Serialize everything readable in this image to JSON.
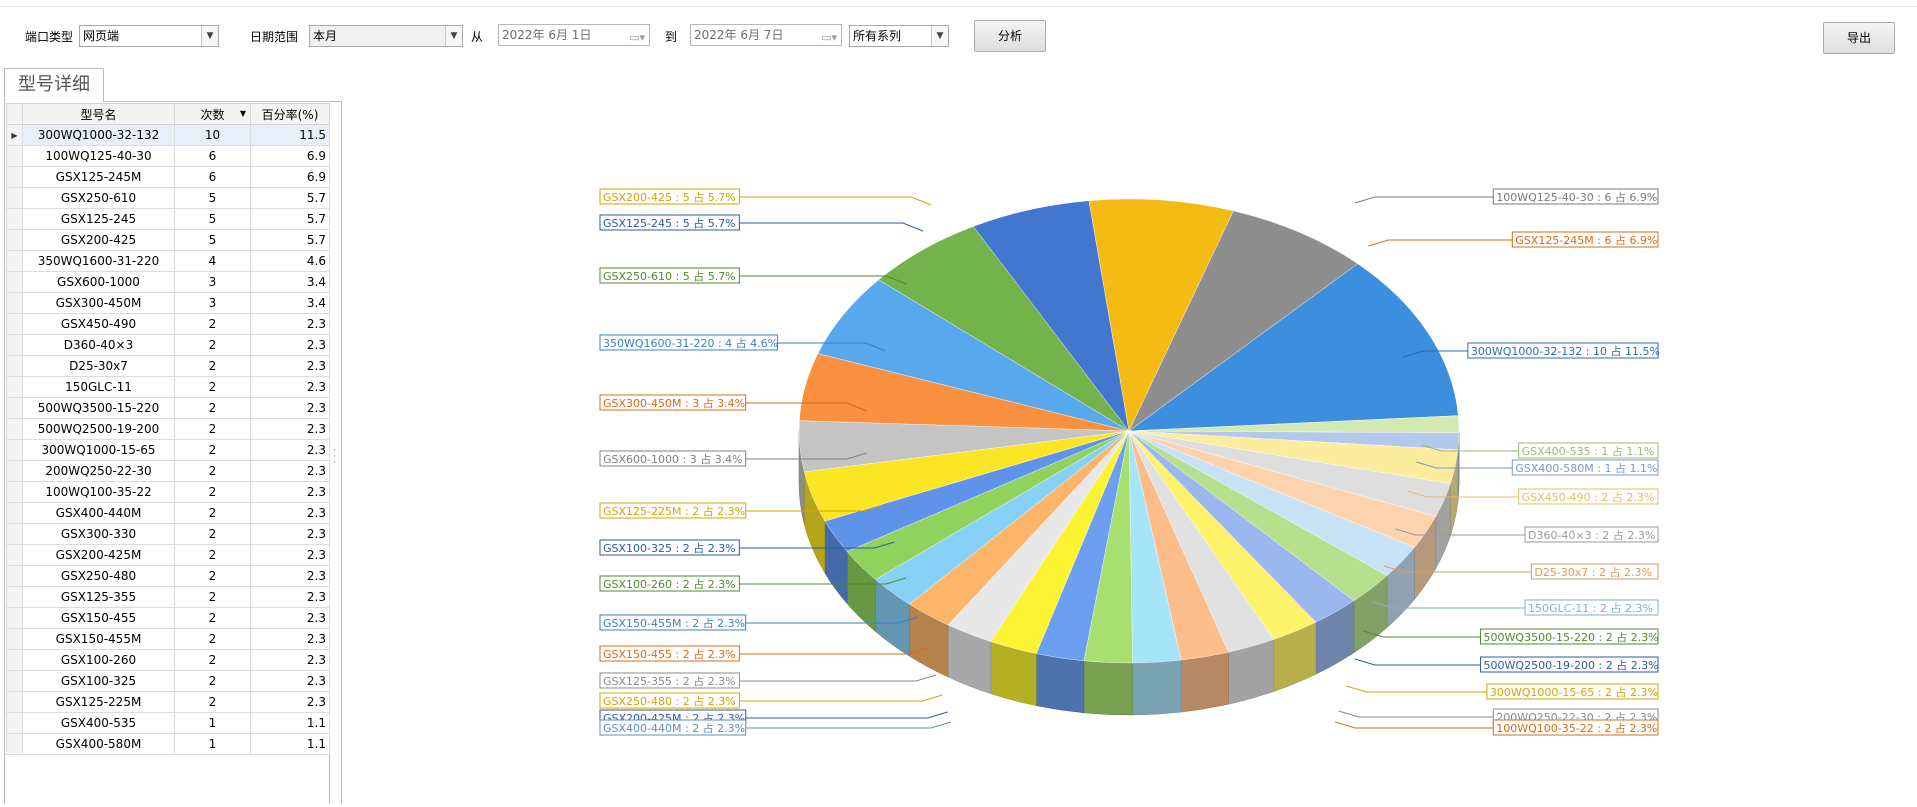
{
  "toolbar": {
    "port_type_label": "端口类型",
    "port_type_value": "网页端",
    "date_range_label": "日期范围",
    "date_range_value": "本月",
    "from_label": "从",
    "date_from": "2022年 6月 1日",
    "to_label": "到",
    "date_to": "2022年 6月 7日",
    "series_value": "所有系列",
    "analyze_label": "分析",
    "export_label": "导出"
  },
  "tab": {
    "label": "型号详细"
  },
  "table": {
    "columns": [
      "型号名",
      "次数",
      "百分率(%)"
    ],
    "rows": [
      {
        "name": "300WQ1000-32-132",
        "count": "10",
        "pct": "11.5"
      },
      {
        "name": "100WQ125-40-30",
        "count": "6",
        "pct": "6.9"
      },
      {
        "name": "GSX125-245M",
        "count": "6",
        "pct": "6.9"
      },
      {
        "name": "GSX250-610",
        "count": "5",
        "pct": "5.7"
      },
      {
        "name": "GSX125-245",
        "count": "5",
        "pct": "5.7"
      },
      {
        "name": "GSX200-425",
        "count": "5",
        "pct": "5.7"
      },
      {
        "name": "350WQ1600-31-220",
        "count": "4",
        "pct": "4.6"
      },
      {
        "name": "GSX600-1000",
        "count": "3",
        "pct": "3.4"
      },
      {
        "name": "GSX300-450M",
        "count": "3",
        "pct": "3.4"
      },
      {
        "name": "GSX450-490",
        "count": "2",
        "pct": "2.3"
      },
      {
        "name": "D360-40×3",
        "count": "2",
        "pct": "2.3"
      },
      {
        "name": "D25-30x7",
        "count": "2",
        "pct": "2.3"
      },
      {
        "name": "150GLC-11",
        "count": "2",
        "pct": "2.3"
      },
      {
        "name": "500WQ3500-15-220",
        "count": "2",
        "pct": "2.3"
      },
      {
        "name": "500WQ2500-19-200",
        "count": "2",
        "pct": "2.3"
      },
      {
        "name": "300WQ1000-15-65",
        "count": "2",
        "pct": "2.3"
      },
      {
        "name": "200WQ250-22-30",
        "count": "2",
        "pct": "2.3"
      },
      {
        "name": "100WQ100-35-22",
        "count": "2",
        "pct": "2.3"
      },
      {
        "name": "GSX400-440M",
        "count": "2",
        "pct": "2.3"
      },
      {
        "name": "GSX300-330",
        "count": "2",
        "pct": "2.3"
      },
      {
        "name": "GSX200-425M",
        "count": "2",
        "pct": "2.3"
      },
      {
        "name": "GSX250-480",
        "count": "2",
        "pct": "2.3"
      },
      {
        "name": "GSX125-355",
        "count": "2",
        "pct": "2.3"
      },
      {
        "name": "GSX150-455",
        "count": "2",
        "pct": "2.3"
      },
      {
        "name": "GSX150-455M",
        "count": "2",
        "pct": "2.3"
      },
      {
        "name": "GSX100-260",
        "count": "2",
        "pct": "2.3"
      },
      {
        "name": "GSX100-325",
        "count": "2",
        "pct": "2.3"
      },
      {
        "name": "GSX125-225M",
        "count": "2",
        "pct": "2.3"
      },
      {
        "name": "GSX400-535",
        "count": "1",
        "pct": "1.1"
      },
      {
        "name": "GSX400-580M",
        "count": "1",
        "pct": "1.1"
      }
    ]
  },
  "chart_data": {
    "type": "pie",
    "style": "3d-exploded-labels",
    "slices": [
      {
        "label": "300WQ1000-32-132 : 10 占 11.5%",
        "value": 10,
        "color": "#3c8ede"
      },
      {
        "label": "GSX400-535 : 1 占 1.1%",
        "value": 1,
        "color": "#d4e8b2"
      },
      {
        "label": "GSX400-580M : 1 占 1.1%",
        "value": 1,
        "color": "#b4c8ec"
      },
      {
        "label": "GSX450-490 : 2 占 2.3%",
        "value": 2,
        "color": "#fbec9e"
      },
      {
        "label": "D360-40×3 : 2 占 2.3%",
        "value": 2,
        "color": "#dedede"
      },
      {
        "label": "D25-30x7 : 2 占 2.3%",
        "value": 2,
        "color": "#fdd3ae"
      },
      {
        "label": "150GLC-11 : 2 占 2.3%",
        "value": 2,
        "color": "#c8e1f5"
      },
      {
        "label": "500WQ3500-15-220 : 2 占 2.3%",
        "value": 2,
        "color": "#b6e08e"
      },
      {
        "label": "500WQ2500-19-200 : 2 占 2.3%",
        "value": 2,
        "color": "#9ab7ee"
      },
      {
        "label": "300WQ1000-15-65 : 2 占 2.3%",
        "value": 2,
        "color": "#fdf36a"
      },
      {
        "label": "200WQ250-22-30 : 2 占 2.3%",
        "value": 2,
        "color": "#e1e1e1"
      },
      {
        "label": "100WQ100-35-22 : 2 占 2.3%",
        "value": 2,
        "color": "#fdbd8a"
      },
      {
        "label": "GSX400-440M : 2 占 2.3%",
        "value": 2,
        "color": "#a6e4f8"
      },
      {
        "label": "GSX200-425M : 2 占 2.3%",
        "value": 2,
        "color": "#a8e070"
      },
      {
        "label": "GSX250-480 : 2 占 2.3%",
        "value": 2,
        "color": "#6c9ff0"
      },
      {
        "label": "GSX125-355 : 2 占 2.3%",
        "value": 2,
        "color": "#fcf332"
      },
      {
        "label": "GSX150-455 : 2 占 2.3%",
        "value": 2,
        "color": "#e8e8e8"
      },
      {
        "label": "GSX150-455M : 2 占 2.3%",
        "value": 2,
        "color": "#fdb56a"
      },
      {
        "label": "GSX100-260 : 2 占 2.3%",
        "value": 2,
        "color": "#88d1f6"
      },
      {
        "label": "GSX100-325 : 2 占 2.3%",
        "value": 2,
        "color": "#8fd35c"
      },
      {
        "label": "GSX125-225M : 2 占 2.3%",
        "value": 2,
        "color": "#5f93ea"
      },
      {
        "label": "GSX600-1000 : 3 占 3.4%",
        "value": 3,
        "color": "#fce524"
      },
      {
        "label": "GSX300-450M : 3 占 3.4%",
        "value": 3,
        "color": "#c4c4c4"
      },
      {
        "label": "350WQ1600-31-220 : 4 占 4.6%",
        "value": 4,
        "color": "#f99140"
      },
      {
        "label": "GSX250-610 : 5 占 5.7%",
        "value": 5,
        "color": "#58a8ee"
      },
      {
        "label": "GSX125-245 : 5 占 5.7%",
        "value": 5,
        "color": "#74b24c"
      },
      {
        "label": "GSX200-425 : 5 占 5.7%",
        "value": 5,
        "color": "#4376ce"
      },
      {
        "label": "100WQ125-40-30 : 6 占 6.9%",
        "value": 6,
        "color": "#f3bb14"
      },
      {
        "label": "GSX125-245M : 6 占 6.9%",
        "value": 6,
        "color": "#8e8e8e"
      }
    ],
    "labels_shown": [
      {
        "text": "GSX200-425 : 5 占 5.7%",
        "side": "left",
        "color": "#d99e00"
      },
      {
        "text": "GSX125-245 : 5 占 5.7%",
        "side": "left",
        "color": "#2b59a8"
      },
      {
        "text": "GSX250-610 : 5 占 5.7%",
        "side": "left",
        "color": "#4f8a2c"
      },
      {
        "text": "350WQ1600-31-220 : 4 占 4.6%",
        "side": "left",
        "color": "#3a7fc8"
      },
      {
        "text": "GSX300-450M : 3 占 3.4%",
        "side": "left",
        "color": "#d86b14"
      },
      {
        "text": "GSX600-1000 : 3 占 3.4%",
        "side": "left",
        "color": "#808080"
      },
      {
        "text": "GSX125-225M : 2 占 2.3%",
        "side": "left",
        "color": "#d9a300"
      },
      {
        "text": "GSX100-325 : 2 占 2.3%",
        "side": "left",
        "color": "#2b59a8"
      },
      {
        "text": "GSX100-260 : 2 占 2.3%",
        "side": "left",
        "color": "#4f8a2c"
      },
      {
        "text": "GSX150-455M : 2 占 2.3%",
        "side": "left",
        "color": "#3a7fc8"
      },
      {
        "text": "GSX150-455 : 2 占 2.3%",
        "side": "left",
        "color": "#d86b14"
      },
      {
        "text": "GSX125-355 : 2 占 2.3%",
        "side": "left",
        "color": "#8a8a8a"
      },
      {
        "text": "GSX250-480 : 2 占 2.3%",
        "side": "left",
        "color": "#d9a300"
      },
      {
        "text": "GSX200-425M : 2 占 2.3%",
        "side": "left",
        "color": "#2b59a8"
      },
      {
        "text": "GSX400-440M : 2 占 2.3%",
        "side": "left",
        "color": "#5d8ec4"
      },
      {
        "text": "100WQ125-40-30 : 6 占 6.9%",
        "side": "right",
        "color": "#7a7a7a"
      },
      {
        "text": "GSX125-245M : 6 占 6.9%",
        "side": "right",
        "color": "#d86b14"
      },
      {
        "text": "300WQ1000-32-132 : 10 占 11.5%",
        "side": "right",
        "color": "#2b6cb8"
      },
      {
        "text": "GSX400-535 : 1 占 1.1%",
        "side": "right",
        "color": "#9ab87a"
      },
      {
        "text": "GSX400-580M : 1 占 1.1%",
        "side": "right",
        "color": "#7a96cc"
      },
      {
        "text": "GSX450-490 : 2 占 2.3%",
        "side": "right",
        "color": "#e0c060"
      },
      {
        "text": "D360-40×3 : 2 占 2.3%",
        "side": "right",
        "color": "#9a9a9a"
      },
      {
        "text": "D25-30x7 : 2 占 2.3%",
        "side": "right",
        "color": "#e0965c"
      },
      {
        "text": "150GLC-11 : 2 占 2.3%",
        "side": "right",
        "color": "#86aed4"
      },
      {
        "text": "500WQ3500-15-220 : 2 占 2.3%",
        "side": "right",
        "color": "#4f8a2c"
      },
      {
        "text": "500WQ2500-19-200 : 2 占 2.3%",
        "side": "right",
        "color": "#2b59a8"
      },
      {
        "text": "300WQ1000-15-65 : 2 占 2.3%",
        "side": "right",
        "color": "#d9a300"
      },
      {
        "text": "200WQ250-22-30 : 2 占 2.3%",
        "side": "right",
        "color": "#8a8a8a"
      },
      {
        "text": "100WQ100-35-22 : 2 占 2.3%",
        "side": "right",
        "color": "#d86b14"
      }
    ]
  }
}
